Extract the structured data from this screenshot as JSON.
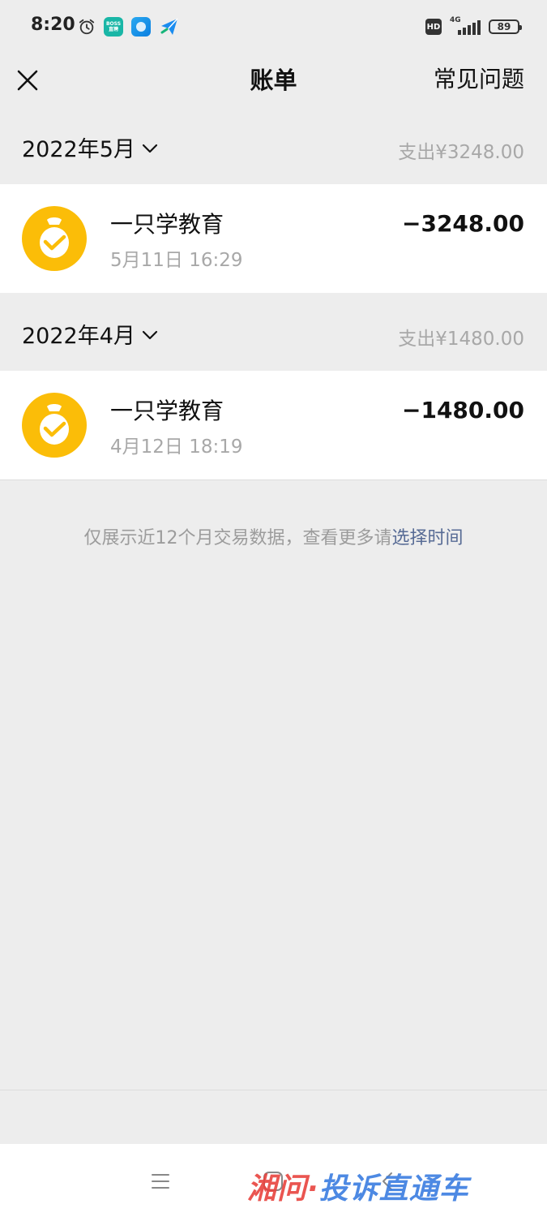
{
  "status_bar": {
    "time": "8:20",
    "boss_label_top": "BOSS",
    "boss_label_bottom": "直聘",
    "network": "4G",
    "battery": "89"
  },
  "header": {
    "title": "账单",
    "faq_label": "常见问题"
  },
  "months": [
    {
      "label": "2022年5月",
      "total": "支出¥3248.00",
      "transactions": [
        {
          "name": "一只学教育",
          "time": "5月11日 16:29",
          "amount": "−3248.00"
        }
      ]
    },
    {
      "label": "2022年4月",
      "total": "支出¥1480.00",
      "transactions": [
        {
          "name": "一只学教育",
          "time": "4月12日 18:19",
          "amount": "−1480.00"
        }
      ]
    }
  ],
  "footer": {
    "note": "仅展示近12个月交易数据，查看更多请",
    "link": "选择时间"
  },
  "watermark": {
    "part1": "湘问·",
    "part2": "投诉直通车"
  },
  "colors": {
    "background": "#ededed",
    "link": "#576b95",
    "avatar_yellow": "#fbbd08",
    "muted_text": "#a8a8a8"
  },
  "icons": {
    "close": "close-icon",
    "chevron": "chevron-down-icon",
    "avatar": "money-bag-icon",
    "system_menu": "menu-icon",
    "system_home": "home-icon",
    "system_back": "back-icon"
  }
}
